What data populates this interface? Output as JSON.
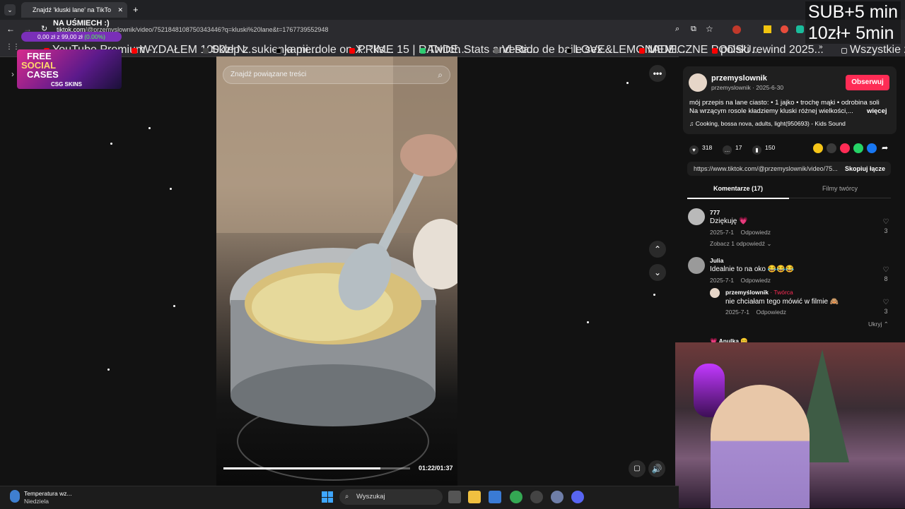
{
  "browser": {
    "tab_title": "Znajdź 'kluski lane' na TikTo",
    "url_domain": "tiktok.com",
    "url_rest": "/@przemyslownik/video/7521848108750343446?q=kluski%20lane&t=1767739552948"
  },
  "bookmarks": [
    {
      "label": "YouTube Premium -...",
      "color": "#ff0000"
    },
    {
      "label": "WYDAŁEM 1000zł N...",
      "color": "#ff0000"
    },
    {
      "label": "Sklep z sukienkami...",
      "color": "#444444"
    },
    {
      "label": "ja pierdole on X: \"ks...",
      "color": "#000000"
    },
    {
      "label": "PRIME 15 | RANDE...",
      "color": "#ff0000"
    },
    {
      "label": "Twitch Stats and Ra...",
      "color": "#2ecc71"
    },
    {
      "label": "Vestido de baile sex...",
      "color": "#666666"
    },
    {
      "label": "LOVE&LEMONADE...",
      "color": "#000000"
    },
    {
      "label": "MEMICZNE PODSU...",
      "color": "#ff0000"
    },
    {
      "label": "polski rewind 2025...",
      "color": "#ff0000"
    }
  ],
  "bookmarks_all": "Wszystkie zakładki",
  "overlay": {
    "sub_line1": "SUB+5 min",
    "sub_line2": "10zł+ 5min",
    "goal_title": "NA UŚMIECH :)",
    "goal_amount": "0,00 zł z 99,00 zł",
    "goal_percent": "(0.00%)",
    "promo_line1": "FREE",
    "promo_line2": "SOCIAL",
    "promo_line3": "CASES",
    "promo_brand": "CSG SKINS"
  },
  "video": {
    "search_placeholder": "Znajdź powiązane treści",
    "time": "01:22/01:37",
    "progress": 0.84
  },
  "creator": {
    "name": "przemyslownik",
    "sub": "przemyslownik · 2025-6-30",
    "follow_label": "Obserwuj",
    "desc_line1": "mój przepis na lane ciasto: • 1 jajko • trochę mąki • odrobina soli",
    "desc_line2": "Na wrzącym rosole kładziemy kluski różnej wielkości,...",
    "more_label": "więcej",
    "sound": "Cooking, bossa nova, adults, light(950693) - Kids Sound"
  },
  "stats": {
    "likes": "318",
    "comments": "17",
    "saves": "150"
  },
  "link": {
    "url": "https://www.tiktok.com/@przemyslownik/video/75...",
    "copy_label": "Skopiuj łącze"
  },
  "tabs": {
    "comments": "Komentarze (17)",
    "videos": "Filmy twórcy"
  },
  "comments": [
    {
      "name": "777",
      "text": "Dziękuję 💗",
      "date": "2025-7-1",
      "reply": "Odpowiedz",
      "likes": "3",
      "replies_label": "Zobacz 1 odpowiedź"
    },
    {
      "name": "Julia",
      "text": "Idealnie to na oko 😂😂😂",
      "date": "2025-7-1",
      "reply": "Odpowiedz",
      "likes": "8"
    }
  ],
  "creator_reply": {
    "name": "przemyślownik",
    "badge": "· Twórca",
    "text": "nie chciałam tego mówić w filmie 🙈",
    "date": "2025-7-1",
    "reply": "Odpowiedz",
    "likes": "3",
    "hide_label": "Ukryj"
  },
  "next_comment": {
    "name": "💗 Anulka 😊"
  },
  "taskbar": {
    "weather_title": "Temperatura wz...",
    "weather_sub": "Niedziela",
    "search": "Wyszukaj"
  }
}
